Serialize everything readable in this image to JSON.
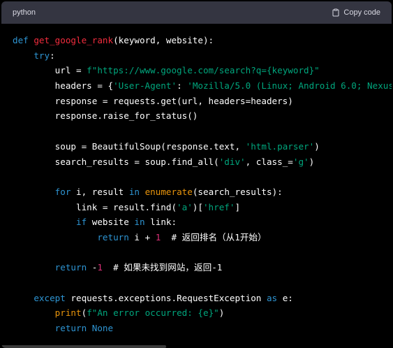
{
  "header": {
    "language": "python",
    "copy_label": "Copy code",
    "copy_icon": "clipboard-icon"
  },
  "code_lines": [
    [
      {
        "t": "def ",
        "c": "kw"
      },
      {
        "t": "get_google_rank",
        "c": "fn"
      },
      {
        "t": "(keyword, website):",
        "c": "plain"
      }
    ],
    [
      {
        "t": "    ",
        "c": "plain"
      },
      {
        "t": "try",
        "c": "kw"
      },
      {
        "t": ":",
        "c": "plain"
      }
    ],
    [
      {
        "t": "        url = ",
        "c": "plain"
      },
      {
        "t": "f\"https://www.google.com/search?q={keyword}\"",
        "c": "str"
      }
    ],
    [
      {
        "t": "        headers = {",
        "c": "plain"
      },
      {
        "t": "'User-Agent'",
        "c": "str"
      },
      {
        "t": ": ",
        "c": "plain"
      },
      {
        "t": "'Mozilla/5.0 (Linux; Android 6.0; Nexus",
        "c": "str"
      }
    ],
    [
      {
        "t": "        response = requests.get(url, headers=headers)",
        "c": "plain"
      }
    ],
    [
      {
        "t": "        response.raise_for_status()",
        "c": "plain"
      }
    ],
    [
      {
        "t": "",
        "c": "plain"
      }
    ],
    [
      {
        "t": "        soup = BeautifulSoup(response.text, ",
        "c": "plain"
      },
      {
        "t": "'html.parser'",
        "c": "str"
      },
      {
        "t": ")",
        "c": "plain"
      }
    ],
    [
      {
        "t": "        search_results = soup.find_all(",
        "c": "plain"
      },
      {
        "t": "'div'",
        "c": "str"
      },
      {
        "t": ", class_=",
        "c": "plain"
      },
      {
        "t": "'g'",
        "c": "str"
      },
      {
        "t": ")",
        "c": "plain"
      }
    ],
    [
      {
        "t": "",
        "c": "plain"
      }
    ],
    [
      {
        "t": "        ",
        "c": "plain"
      },
      {
        "t": "for",
        "c": "kw"
      },
      {
        "t": " i, result ",
        "c": "plain"
      },
      {
        "t": "in",
        "c": "kw"
      },
      {
        "t": " ",
        "c": "plain"
      },
      {
        "t": "enumerate",
        "c": "bi"
      },
      {
        "t": "(search_results):",
        "c": "plain"
      }
    ],
    [
      {
        "t": "            link = result.find(",
        "c": "plain"
      },
      {
        "t": "'a'",
        "c": "str"
      },
      {
        "t": ")[",
        "c": "plain"
      },
      {
        "t": "'href'",
        "c": "str"
      },
      {
        "t": "]",
        "c": "plain"
      }
    ],
    [
      {
        "t": "            ",
        "c": "plain"
      },
      {
        "t": "if",
        "c": "kw"
      },
      {
        "t": " website ",
        "c": "plain"
      },
      {
        "t": "in",
        "c": "kw"
      },
      {
        "t": " link:",
        "c": "plain"
      }
    ],
    [
      {
        "t": "                ",
        "c": "plain"
      },
      {
        "t": "return",
        "c": "kw"
      },
      {
        "t": " i + ",
        "c": "plain"
      },
      {
        "t": "1",
        "c": "num"
      },
      {
        "t": "  # 返回排名（从1开始）",
        "c": "cm"
      }
    ],
    [
      {
        "t": "",
        "c": "plain"
      }
    ],
    [
      {
        "t": "        ",
        "c": "plain"
      },
      {
        "t": "return",
        "c": "kw"
      },
      {
        "t": " -",
        "c": "plain"
      },
      {
        "t": "1",
        "c": "num"
      },
      {
        "t": "  # 如果未找到网站，返回-1",
        "c": "cm"
      }
    ],
    [
      {
        "t": "",
        "c": "plain"
      }
    ],
    [
      {
        "t": "    ",
        "c": "plain"
      },
      {
        "t": "except",
        "c": "kw"
      },
      {
        "t": " requests.exceptions.RequestException ",
        "c": "plain"
      },
      {
        "t": "as",
        "c": "kw"
      },
      {
        "t": " e:",
        "c": "plain"
      }
    ],
    [
      {
        "t": "        ",
        "c": "plain"
      },
      {
        "t": "print",
        "c": "bi"
      },
      {
        "t": "(",
        "c": "plain"
      },
      {
        "t": "f\"An error occurred: {e}\"",
        "c": "str"
      },
      {
        "t": ")",
        "c": "plain"
      }
    ],
    [
      {
        "t": "        ",
        "c": "plain"
      },
      {
        "t": "return",
        "c": "kw"
      },
      {
        "t": " ",
        "c": "plain"
      },
      {
        "t": "None",
        "c": "kw"
      }
    ]
  ],
  "colors": {
    "keyword": "#2e95d3",
    "function_name": "#f22c3d",
    "builtin": "#e9950c",
    "string": "#00a67d",
    "number": "#df3079",
    "header_bg": "#343541",
    "code_bg": "#000000"
  }
}
